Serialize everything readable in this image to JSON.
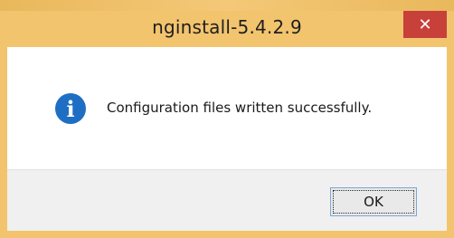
{
  "window": {
    "title": "nginstall-5.4.2.9",
    "close_glyph": "✕",
    "frame_color": "#f3c46e",
    "close_color": "#c7403a"
  },
  "message": {
    "icon": "info-icon",
    "icon_glyph": "i",
    "text": "Configuration files written successfully."
  },
  "buttons": {
    "ok_label": "OK"
  }
}
